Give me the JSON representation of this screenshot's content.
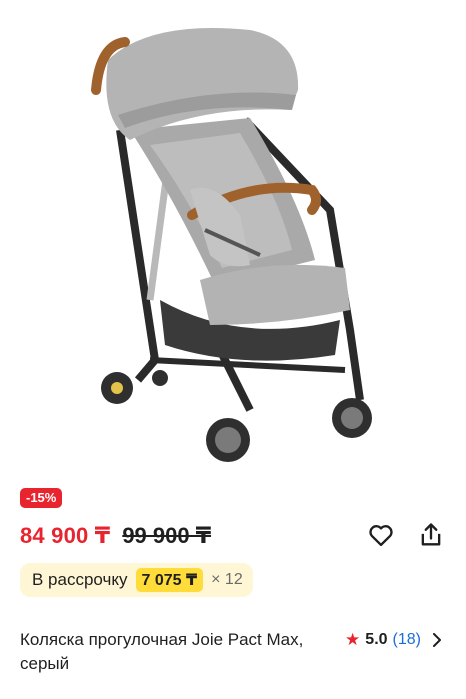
{
  "product": {
    "discount_badge": "-15%",
    "price_current": "84 900 ₸",
    "price_old": "99 900 ₸",
    "installment": {
      "label": "В рассрочку",
      "amount": "7 075 ₸",
      "times": "× 12"
    },
    "title": "Коляска прогулочная Joie Pact Max, серый",
    "rating": {
      "score": "5.0",
      "count": "(18)"
    }
  },
  "icons": {
    "favorite": "heart-icon",
    "share": "share-icon",
    "rating_star": "star-icon",
    "rating_more": "chevron-right-icon"
  },
  "colors": {
    "accent_red": "#e8242e",
    "installment_bg": "#fff6d5",
    "installment_chip": "#ffdc3a",
    "link_blue": "#1a6ed8"
  }
}
